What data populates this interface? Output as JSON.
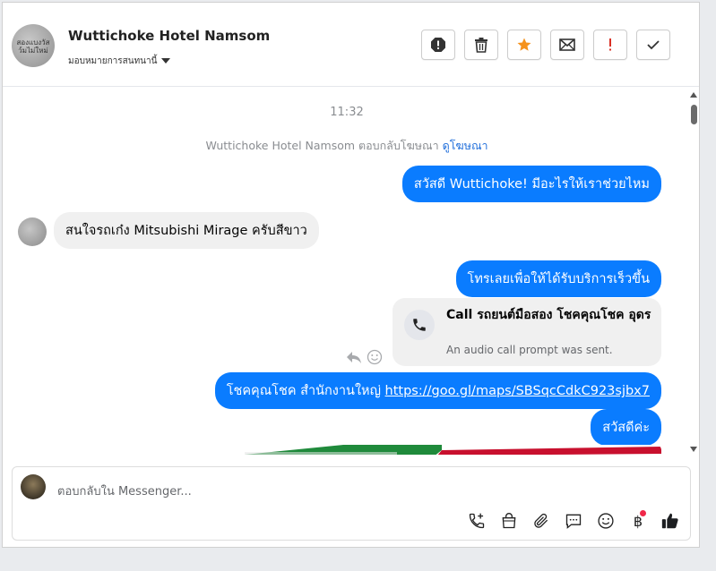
{
  "header": {
    "title": "Wuttichoke Hotel Namsom",
    "subtitle": "มอบหมายการสนทนานี้",
    "avatar_text": "สองแบงวัสว์มไม่ใหม่",
    "toolbar": {
      "icons": [
        "spam-icon",
        "trash-icon",
        "star-icon",
        "mail-icon",
        "important-icon",
        "check-icon"
      ],
      "star_color": "#f5921c",
      "important_color": "#d93025"
    }
  },
  "chat": {
    "time": "11:32",
    "system_line": "Wuttichoke Hotel Namsom ตอบกลับโฆษณา",
    "system_link": "ดูโฆษณา",
    "messages": [
      {
        "dir": "out",
        "text": "สวัสดี Wuttichoke! มีอะไรให้เราช่วยไหม"
      },
      {
        "dir": "in",
        "text": "สนใจรถเก๋ง Mitsubishi Mirage ครับสีขาว"
      },
      {
        "dir": "out",
        "text": "โทรเลยเพื่อให้ได้รับบริการเร็วขึ้น"
      },
      {
        "dir": "out",
        "text": "โชคคุณโชค สำนักงานใหญ่ ",
        "link": "https://goo.gl/maps/SBSqcCdkC923sjbx7"
      },
      {
        "dir": "out",
        "text": "สวัสดีค่ะ"
      }
    ],
    "call_card": {
      "title": "Call รถยนต์มือสอง โชคคุณโชค อุดร",
      "subtitle": "An audio call prompt was sent."
    },
    "outgoing_color": "#0a7cff",
    "incoming_color": "#f0f0f0"
  },
  "composer": {
    "placeholder": "ตอบกลับใน Messenger...",
    "icons": [
      "call-add-icon",
      "shopping-bag-icon",
      "attachment-icon",
      "saved-reply-icon",
      "emoji-icon",
      "baht-icon",
      "like-icon"
    ],
    "baht_symbol": "฿"
  }
}
